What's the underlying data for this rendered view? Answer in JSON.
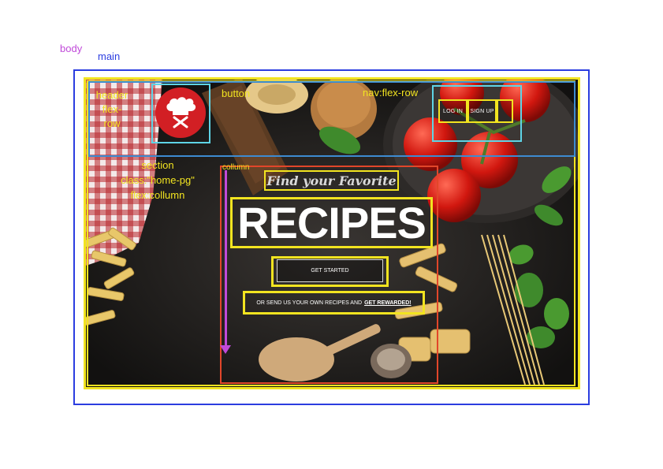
{
  "annotations": {
    "body": "body",
    "main": "main",
    "header": "header\nflex-\nrow",
    "button": "button",
    "nav": "nav:flex-row",
    "section": "section\nclass:\"home-pg\"\nflex:collumn",
    "column": "collumn"
  },
  "nav": {
    "login_label": "LOG IN",
    "signup_label": "SIGN UP"
  },
  "hero": {
    "kicker": "Find your Favorite",
    "title": "RECIPES",
    "cta_label": "GET STARTED",
    "send_text": "OR SEND US YOUR OWN RECIPES AND",
    "send_link": "GET REWARDED!"
  },
  "logo": {
    "icon": "chef-hat-icon",
    "color": "#d21f24"
  },
  "colors": {
    "body_label": "#c04ad9",
    "main_outline": "#2b3de0",
    "flex_outline": "#f2e420",
    "header_outline": "#3d8bd1",
    "item_outline": "#5ed4e6",
    "column_outline": "#e2462a"
  }
}
